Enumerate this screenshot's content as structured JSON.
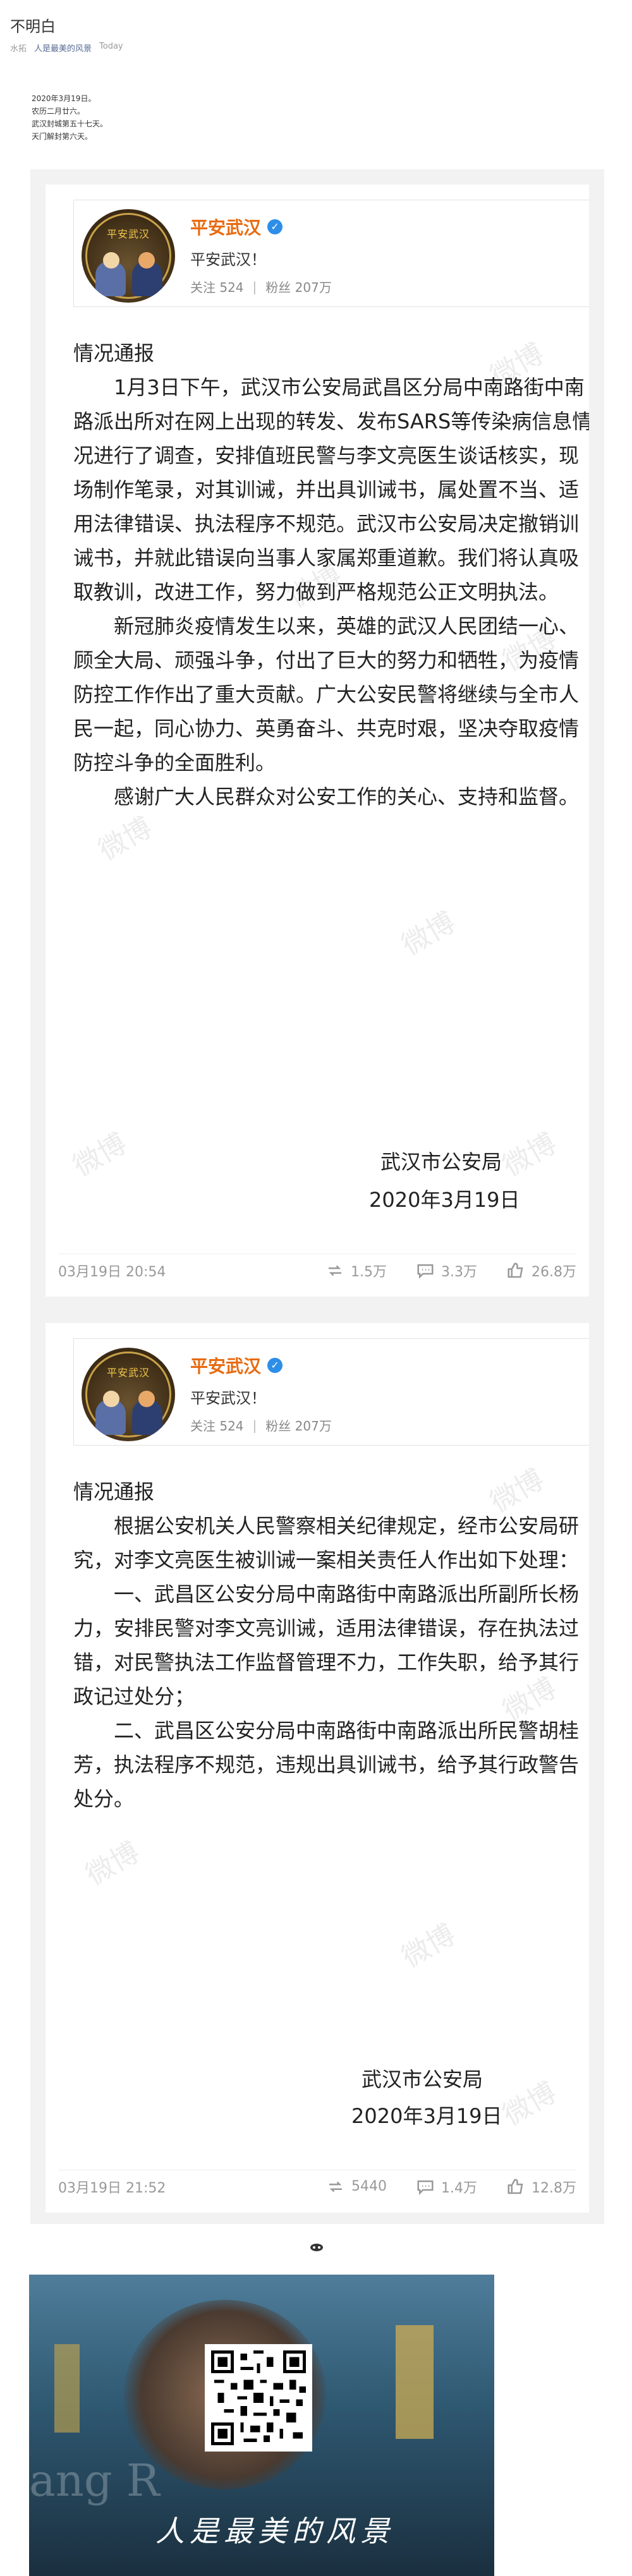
{
  "article": {
    "title": "不明白",
    "author": "水拓",
    "account": "人是最美的风景",
    "date": "Today",
    "intro_lines": [
      "2020年3月19日。",
      "农历二月廿六。",
      "武汉封城第五十七天。",
      "天门解封第六天。"
    ]
  },
  "posts": [
    {
      "profile": {
        "name": "平安武汉",
        "avatar_text": "平安武汉",
        "description": "平安武汉！",
        "follow_label": "关注",
        "follow_count": "524",
        "fans_label": "粉丝",
        "fans_count": "207万"
      },
      "paragraphs": [
        "情况通报",
        "　　1月3日下午，武汉市公安局武昌区分局中南路街中南路派出所对在网上出现的转发、发布SARS等传染病信息情况进行了调查，安排值班民警与李文亮医生谈话核实，现场制作笔录，对其训诫，并出具训诫书，属处置不当、适用法律错误、执法程序不规范。武汉市公安局决定撤销训诫书，并就此错误向当事人家属郑重道歉。我们将认真吸取教训，改进工作，努力做到严格规范公正文明执法。",
        "　　新冠肺炎疫情发生以来，英雄的武汉人民团结一心、顾全大局、顽强斗争，付出了巨大的努力和牺牲，为疫情防控工作作出了重大贡献。广大公安民警将继续与全市人民一起，同心协力、英勇奋斗、共克时艰，坚决夺取疫情防控斗争的全面胜利。",
        "　　感谢广大人民群众对公安工作的关心、支持和监督。"
      ],
      "signature": "武汉市公安局",
      "sign_date": "2020年3月19日",
      "time": "03月19日 20:54",
      "reposts": "1.5万",
      "comments": "3.3万",
      "likes": "26.8万"
    },
    {
      "profile": {
        "name": "平安武汉",
        "avatar_text": "平安武汉",
        "description": "平安武汉！",
        "follow_label": "关注",
        "follow_count": "524",
        "fans_label": "粉丝",
        "fans_count": "207万"
      },
      "paragraphs": [
        "情况通报",
        "　　根据公安机关人民警察相关纪律规定，经市公安局研究，对李文亮医生被训诫一案相关责任人作出如下处理：",
        "　　一、武昌区公安分局中南路街中南路派出所副所长杨力，安排民警对李文亮训诫，适用法律错误，存在执法过错，对民警执法工作监督管理不力，工作失职，给予其行政记过处分；",
        "　　二、武昌区公安分局中南路街中南路派出所民警胡桂芳，执法程序不规范，违规出具训诫书，给予其行政警告处分。"
      ],
      "signature": "武汉市公安局",
      "sign_date": "2020年3月19日",
      "time": "03月19日 21:52",
      "reposts": "5440",
      "comments": "1.4万",
      "likes": "12.8万"
    }
  ],
  "watermark_text": "微博",
  "poster": {
    "slogan": "人是最美的风景",
    "bg_text": "ang R"
  },
  "colors": {
    "brand": "#e86a10",
    "verify": "#2d8ee8",
    "link": "#576b95",
    "card_bg": "#f2f2f2"
  },
  "icons": [
    "verified-icon",
    "repost-icon",
    "comment-icon",
    "like-icon",
    "qr-code-icon",
    "ornament-icon"
  ]
}
